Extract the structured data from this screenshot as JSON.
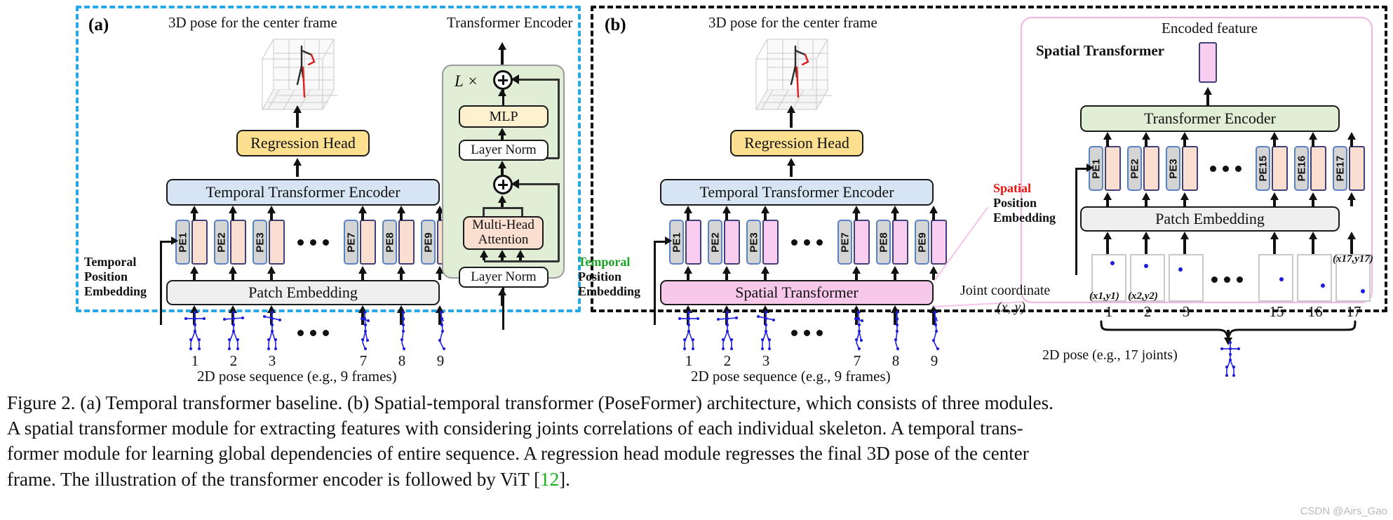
{
  "figure": {
    "panel_a_tag": "(a)",
    "panel_b_tag": "(b)",
    "watermark": "CSDN @Airs_Gao"
  },
  "panel_a": {
    "top_label": "3D pose for the center frame",
    "regression_head": "Regression Head",
    "temporal_encoder": "Temporal Transformer Encoder",
    "patch_embedding": "Patch Embedding",
    "position_embedding_label": "Temporal\nPosition\nEmbedding",
    "position_embedding_line1": "Temporal",
    "position_embedding_line2": "Position",
    "position_embedding_line3": "Embedding",
    "bottom_caption": "2D pose sequence (e.g., 9 frames)",
    "pe_tokens": [
      "PE1",
      "PE2",
      "PE3",
      "PE7",
      "PE8",
      "PE9"
    ],
    "frame_numbers": [
      "1",
      "2",
      "3",
      "7",
      "8",
      "9"
    ]
  },
  "transformer_encoder": {
    "title": "Transformer Encoder",
    "repeat_label": "L ×",
    "mlp": "MLP",
    "layer_norm_top": "Layer Norm",
    "multi_head_attention_line1": "Multi-Head",
    "multi_head_attention_line2": "Attention",
    "layer_norm_bottom": "Layer Norm"
  },
  "panel_b": {
    "top_label": "3D pose for the center frame",
    "regression_head": "Regression Head",
    "temporal_encoder": "Temporal Transformer Encoder",
    "spatial_transformer_block": "Spatial Transformer",
    "position_embedding_line1": "Temporal",
    "position_embedding_line2": "Position",
    "position_embedding_line3": "Embedding",
    "bottom_caption": "2D pose sequence (e.g., 9 frames)",
    "pe_tokens": [
      "PE1",
      "PE2",
      "PE3",
      "PE7",
      "PE8",
      "PE9"
    ],
    "frame_numbers": [
      "1",
      "2",
      "3",
      "7",
      "8",
      "9"
    ]
  },
  "spatial_detail": {
    "title": "Spatial Transformer",
    "encoded_feature": "Encoded feature",
    "transformer_encoder": "Transformer Encoder",
    "patch_embedding": "Patch Embedding",
    "position_embedding_line1": "Spatial",
    "position_embedding_line2": "Position",
    "position_embedding_line3": "Embedding",
    "joint_coordinate_line1": "Joint coordinate",
    "joint_coordinate_line2": "(x, y)",
    "bottom_caption": "2D pose (e.g., 17 joints)",
    "pe_tokens": [
      "PE1",
      "PE2",
      "PE3",
      "PE15",
      "PE16",
      "PE17"
    ],
    "joint_numbers": [
      "1",
      "2",
      "3",
      "15",
      "16",
      "17"
    ],
    "joint_coords": [
      "(x1,y1)",
      "(x2,y2)",
      "(x17,y17)"
    ]
  },
  "colors": {
    "panel_a_border": "#27a8e6",
    "panel_b_border": "#111111",
    "regression_head": "#fcdf8f",
    "temporal_encoder": "#d7e4f3",
    "patch_embedding": "#efefef",
    "spatial_transformer": "#f8c8ea",
    "encoder_green": "#dfeed4",
    "mlp": "#fdf1cf",
    "attention": "#fadfd1",
    "position_token": "#d4d4d4",
    "feature_peach": "#fadfd1",
    "feature_pink": "#f9cdf0",
    "spatial_accent": "#e8140c",
    "temporal_accent": "#17a321",
    "skeleton": "#1a1ae0",
    "reference_link": "#18b018"
  },
  "caption": {
    "text_1": "Figure 2. (a) Temporal transformer baseline. (b) Spatial-temporal transformer (PoseFormer) architecture, which consists of three modules.",
    "text_2": "A spatial transformer module for extracting features with considering joints correlations of each individual skeleton.  A temporal trans-",
    "text_3": "former module for learning global dependencies of entire sequence.  A regression head module regresses the final 3D pose of the center",
    "text_4_pre": "frame. The illustration of the transformer encoder is followed by ViT [",
    "text_4_ref": "12",
    "text_4_post": "]."
  }
}
